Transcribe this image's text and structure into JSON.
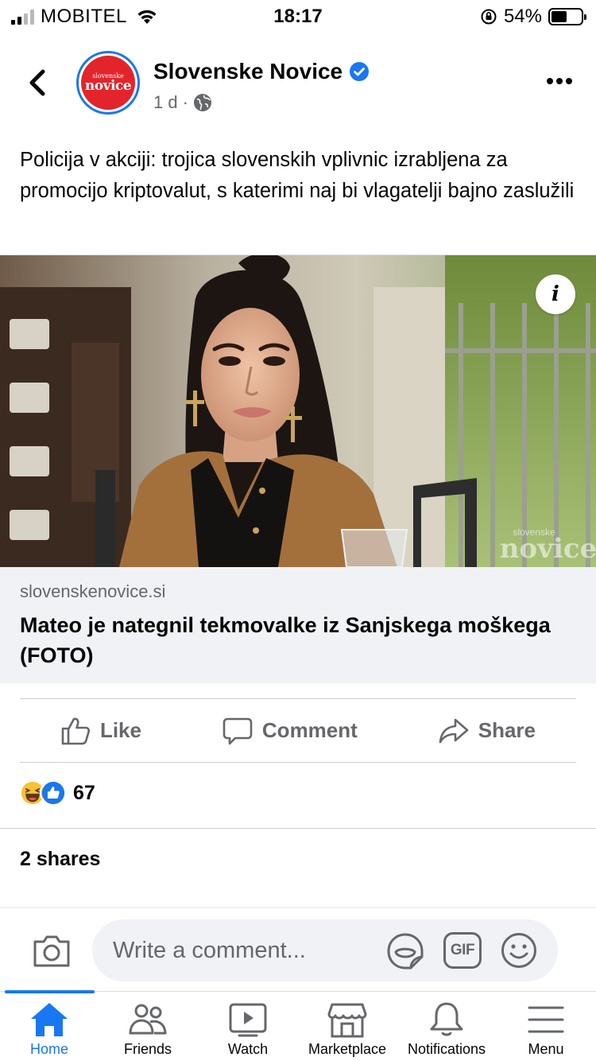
{
  "status_bar": {
    "carrier": "MOBITEL",
    "time": "18:17",
    "battery_percent": "54%",
    "battery_level": 0.54
  },
  "post": {
    "back_icon": "chevron-left-icon",
    "page_name": "Slovenske Novice",
    "avatar_logo_text": "slovenske novice",
    "verified_icon": "verified-badge-icon",
    "timestamp": "1 d",
    "separator": "·",
    "privacy_icon": "globe-icon",
    "text": "Policija v akciji: trojica slovenskih vplivnic izrabljena za promocijo kriptovalut, s katerimi naj bi vlagatelji bajno zaslužili"
  },
  "link_preview": {
    "domain": "slovenskenovice.si",
    "title": "Mateo je nategnil tekmovalke iz Sanjskega moškega (FOTO)",
    "info_label": "i",
    "watermark": "slovenske novice"
  },
  "actions": {
    "like": "Like",
    "comment": "Comment",
    "share": "Share"
  },
  "reactions": {
    "types": [
      "haha",
      "like"
    ],
    "count": "67"
  },
  "shares_text": "2 shares",
  "composer": {
    "placeholder": "Write a comment...",
    "gif_label": "GIF"
  },
  "tabbar": {
    "active": "Home",
    "tabs": [
      {
        "label": "Home",
        "icon": "home-icon"
      },
      {
        "label": "Friends",
        "icon": "friends-icon"
      },
      {
        "label": "Watch",
        "icon": "watch-icon"
      },
      {
        "label": "Marketplace",
        "icon": "marketplace-icon"
      },
      {
        "label": "Notifications",
        "icon": "bell-icon"
      },
      {
        "label": "Menu",
        "icon": "menu-icon"
      }
    ]
  },
  "colors": {
    "accent": "#1877f2",
    "secondary_text": "#65676b",
    "brand_red": "#e3242b"
  }
}
